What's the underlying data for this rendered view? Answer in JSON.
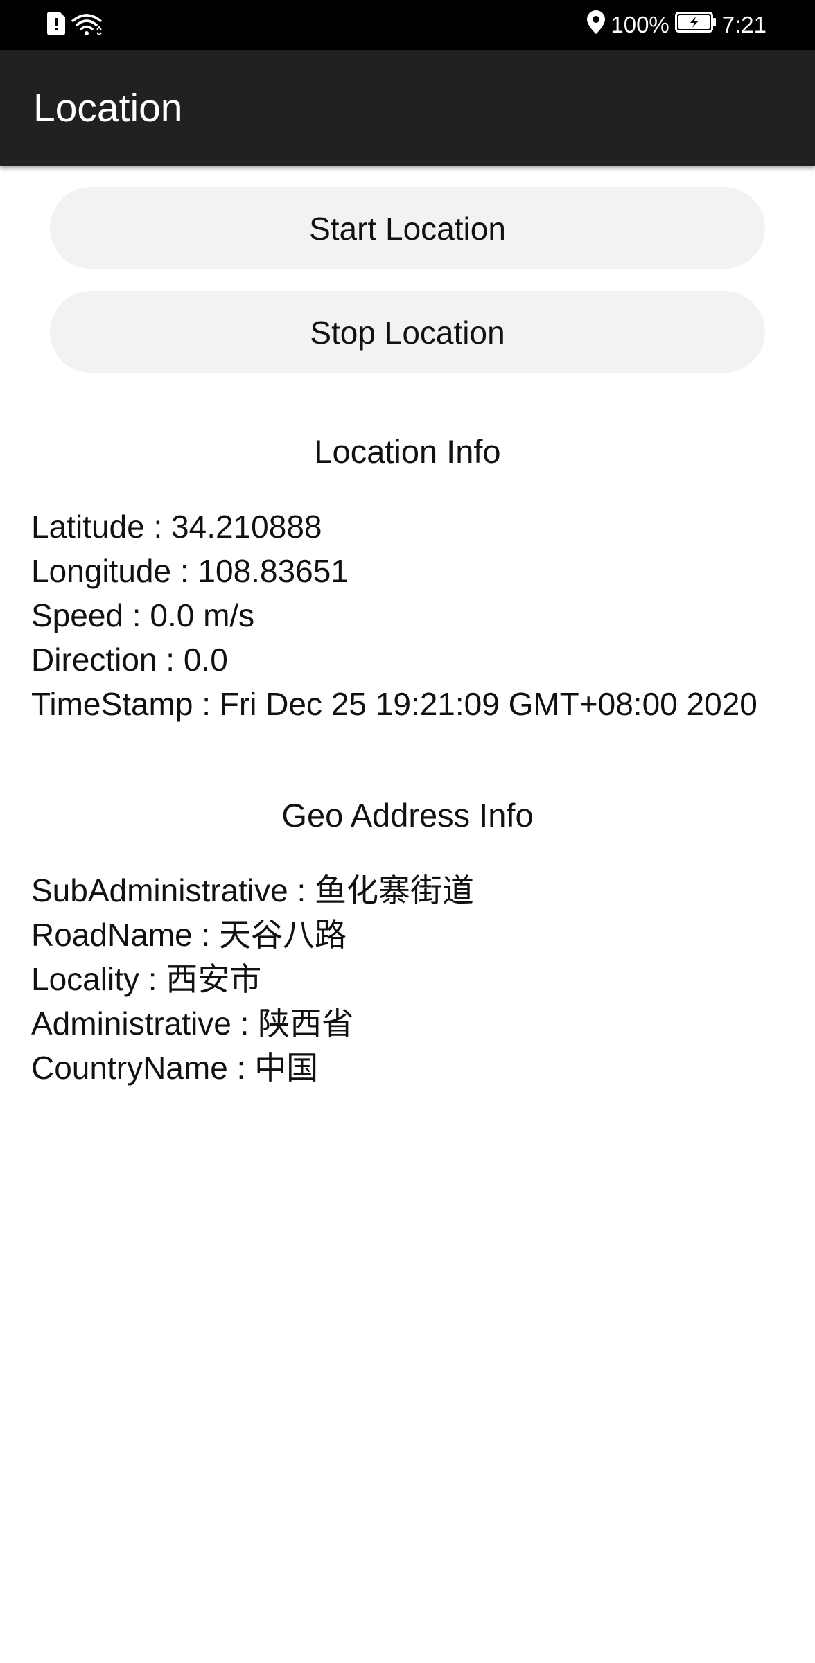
{
  "status_bar": {
    "battery_text": "100%",
    "time": "7:21",
    "icons": [
      "sim-card-icon",
      "wifi-icon",
      "location-pin-icon",
      "battery-charging-icon"
    ]
  },
  "app_bar": {
    "title": "Location"
  },
  "buttons": {
    "start_label": "Start Location",
    "stop_label": "Stop Location"
  },
  "location_info": {
    "title": "Location Info",
    "lines": [
      "Latitude : 34.210888",
      "Longitude : 108.83651",
      "Speed : 0.0 m/s",
      "Direction : 0.0",
      "TimeStamp : Fri Dec 25 19:21:09 GMT+08:00 2020"
    ]
  },
  "geo_address_info": {
    "title": "Geo Address Info",
    "lines": [
      "SubAdministrative : 鱼化寨街道",
      "RoadName : 天谷八路",
      "Locality : 西安市",
      "Administrative : 陕西省",
      "CountryName : 中国"
    ]
  },
  "colors": {
    "status_bar_bg": "#000000",
    "app_bar_bg": "#212121",
    "button_bg": "#f2f2f2"
  }
}
